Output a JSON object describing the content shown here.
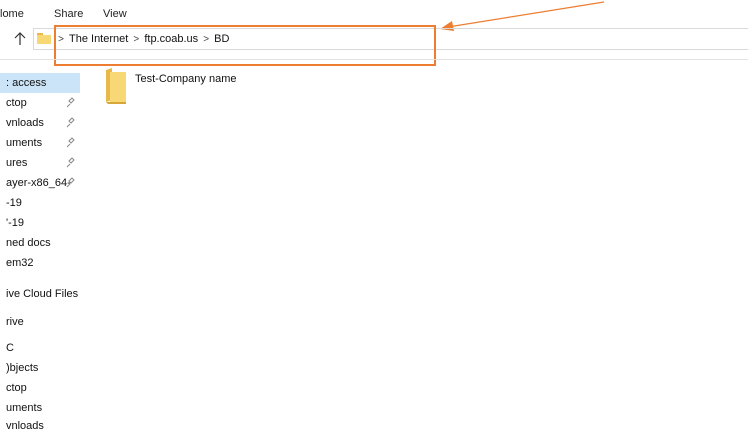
{
  "ribbon": {
    "tabs": [
      {
        "label": "lome"
      },
      {
        "label": "Share"
      },
      {
        "label": "View"
      }
    ]
  },
  "address_bar": {
    "breadcrumbs": [
      "The Internet",
      "ftp.coab.us",
      "BD"
    ]
  },
  "annotation": {
    "highlight_color": "#ed7d31"
  },
  "nav_pane": {
    "items": [
      {
        "label": ": access",
        "selected": true,
        "pinned": false
      },
      {
        "label": "ctop",
        "pinned": true
      },
      {
        "label": "vnloads",
        "pinned": true
      },
      {
        "label": "uments",
        "pinned": true
      },
      {
        "label": "ures",
        "pinned": true
      },
      {
        "label": "ayer-x86_64-",
        "pinned": true
      },
      {
        "label": "-19",
        "pinned": false
      },
      {
        "label": "'-19",
        "pinned": false
      },
      {
        "label": "ned docs",
        "pinned": false
      },
      {
        "label": "em32",
        "pinned": false
      },
      {
        "label": "ive Cloud Files",
        "pinned": false
      },
      {
        "label": "rive",
        "pinned": false
      },
      {
        "label": "C",
        "pinned": false
      },
      {
        "label": ")bjects",
        "pinned": false
      },
      {
        "label": "ctop",
        "pinned": false
      },
      {
        "label": "uments",
        "pinned": false
      },
      {
        "label": "vnloads",
        "pinned": false
      }
    ]
  },
  "content": {
    "items": [
      {
        "name": "Test-Company name",
        "icon": "folder-icon"
      }
    ]
  },
  "colors": {
    "selection": "#cce4f7",
    "folder": "#f8d775",
    "accent": "#ed7d31"
  }
}
